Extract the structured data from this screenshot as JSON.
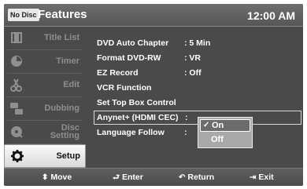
{
  "header": {
    "disc_status": "No Disc",
    "title": "Features",
    "clock": "12:00 AM"
  },
  "sidebar": {
    "items": [
      {
        "label": "Title List",
        "icon": "title-list-icon",
        "active": false
      },
      {
        "label": "Timer",
        "icon": "timer-icon",
        "active": false
      },
      {
        "label": "Edit",
        "icon": "scissors-icon",
        "active": false
      },
      {
        "label": "Dubbing",
        "icon": "dubbing-icon",
        "active": false
      },
      {
        "label": "Disc Setting",
        "icon": "disc-icon",
        "active": false
      },
      {
        "label": "Setup",
        "icon": "gear-icon",
        "active": true
      }
    ]
  },
  "menu": {
    "rows": [
      {
        "label": "DVD Auto Chapter",
        "value": ": 5 Min"
      },
      {
        "label": "Format DVD-RW",
        "value": ": VR"
      },
      {
        "label": "EZ Record",
        "value": ": Off"
      },
      {
        "label": "VCR Function",
        "value": ""
      },
      {
        "label": "Set Top Box Control",
        "value": ""
      },
      {
        "label": "Anynet+ (HDMI CEC)",
        "value": ":"
      },
      {
        "label": "Language Follow",
        "value": ":"
      }
    ],
    "selected_index": 5
  },
  "popup": {
    "options": [
      {
        "label": "On",
        "selected": true,
        "check": "✓"
      },
      {
        "label": "Off",
        "selected": false
      }
    ]
  },
  "footer": {
    "move": "Move",
    "enter": "Enter",
    "return": "Return",
    "exit": "Exit"
  }
}
